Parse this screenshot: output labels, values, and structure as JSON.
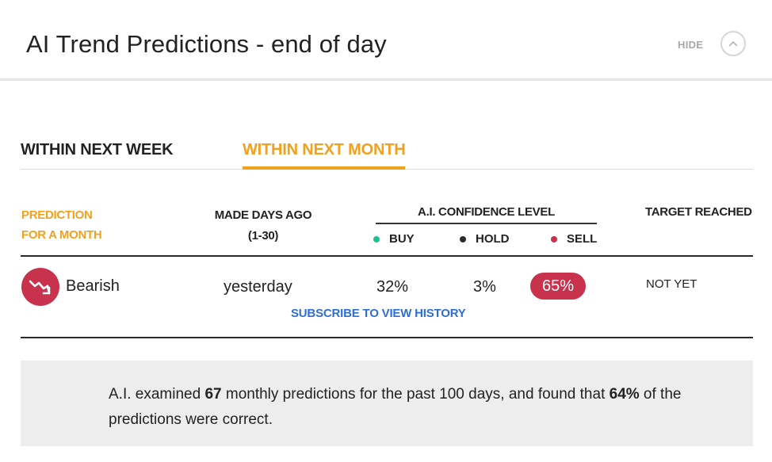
{
  "header": {
    "title": "AI Trend Predictions - end of day",
    "hide_label": "HIDE"
  },
  "tabs": [
    {
      "label": "WITHIN NEXT WEEK",
      "active": false
    },
    {
      "label": "WITHIN NEXT MONTH",
      "active": true
    }
  ],
  "table": {
    "col_prediction_line1": "PREDICTION",
    "col_prediction_line2": "FOR A MONTH",
    "col_days_line1": "MADE DAYS AGO",
    "col_days_line2": "(1-30)",
    "col_confidence": "A.I. CONFIDENCE LEVEL",
    "col_target": "TARGET REACHED",
    "legend": {
      "buy": "BUY",
      "hold": "HOLD",
      "sell": "SELL"
    },
    "row": {
      "prediction": "Bearish",
      "made": "yesterday",
      "buy": "32%",
      "hold": "3%",
      "sell": "65%",
      "target": "NOT YET"
    },
    "subscribe_link": "SUBSCRIBE TO VIEW HISTORY"
  },
  "summary": {
    "part1": "A.I. examined ",
    "count": "67",
    "part2": " monthly predictions for the past 100 days, and found that ",
    "accuracy": "64%",
    "part3": " of the predictions were correct."
  },
  "colors": {
    "accent_orange": "#f2a11f",
    "buy": "#1fbf8f",
    "hold": "#2a2a2a",
    "sell": "#c8324d",
    "link": "#2f6fd2"
  },
  "icons": {
    "hide_button": "chevron-up-icon",
    "prediction": "trend-down-icon"
  }
}
